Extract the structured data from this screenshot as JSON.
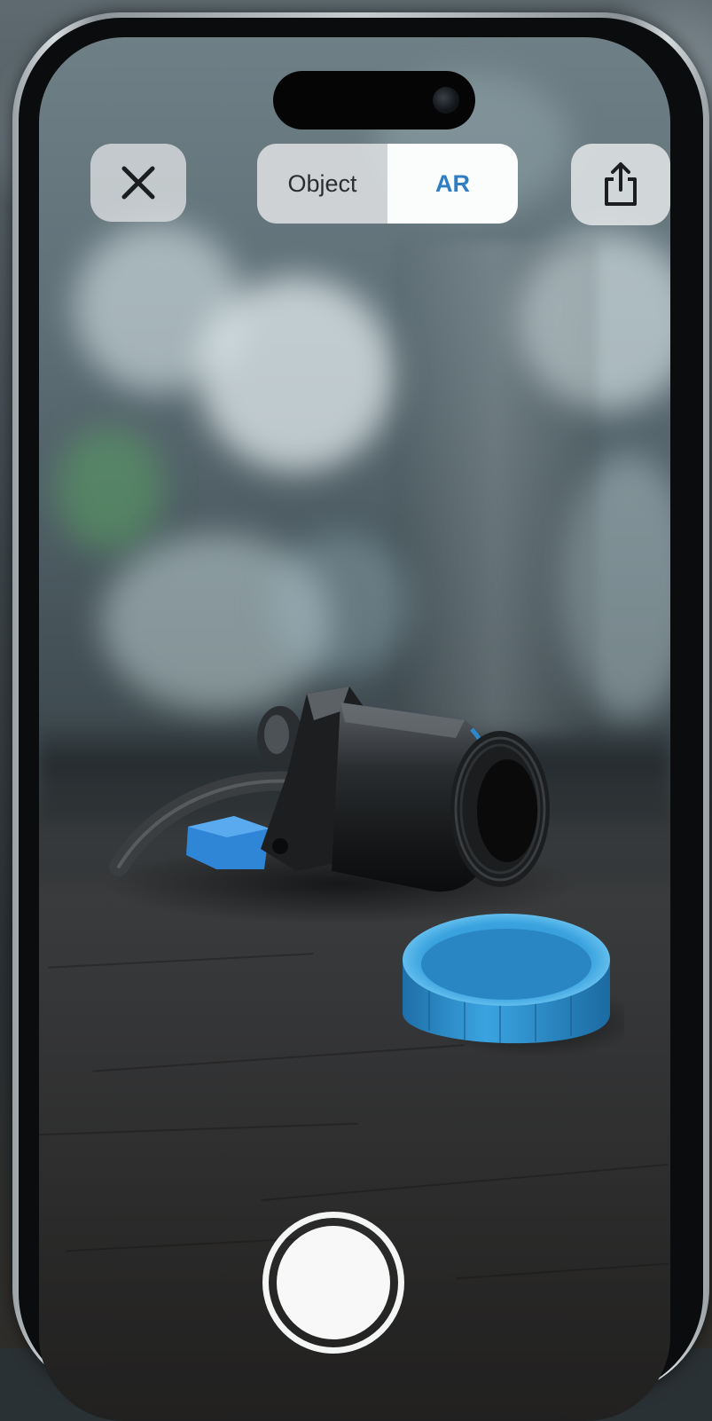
{
  "toolbar": {
    "close_icon": "close-icon",
    "share_icon": "share-icon",
    "mode_options": [
      "Object",
      "AR"
    ],
    "selected_mode": "AR"
  },
  "colors": {
    "accent": "#2f7ec4",
    "button_bg": "#e1e4e5",
    "cap_blue": "#2f98d8"
  },
  "camera": {
    "shutter_icon": "shutter-button"
  }
}
